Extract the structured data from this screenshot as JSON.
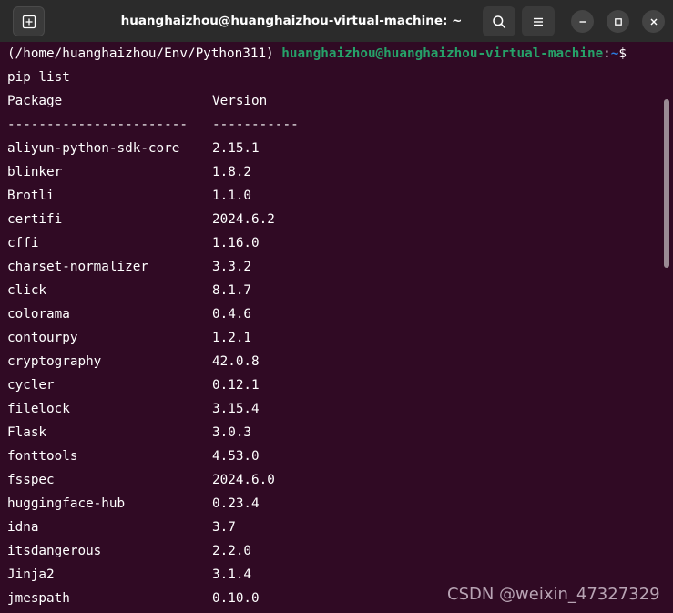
{
  "window": {
    "title": "huanghaizhou@huanghaizhou-virtual-machine: ~"
  },
  "terminal": {
    "prompt": {
      "env": "(/home/huanghaizhou/Env/Python311) ",
      "user_host": "huanghaizhou@huanghaizhou-virtual-machine",
      "colon": ":",
      "path": "~",
      "symbol": "$"
    },
    "command": "pip list",
    "header": {
      "package": "Package",
      "version": "Version"
    },
    "separator": {
      "package": "-----------------------",
      "version": "-----------"
    },
    "packages": [
      {
        "name": "aliyun-python-sdk-core",
        "version": "2.15.1"
      },
      {
        "name": "blinker",
        "version": "1.8.2"
      },
      {
        "name": "Brotli",
        "version": "1.1.0"
      },
      {
        "name": "certifi",
        "version": "2024.6.2"
      },
      {
        "name": "cffi",
        "version": "1.16.0"
      },
      {
        "name": "charset-normalizer",
        "version": "3.3.2"
      },
      {
        "name": "click",
        "version": "8.1.7"
      },
      {
        "name": "colorama",
        "version": "0.4.6"
      },
      {
        "name": "contourpy",
        "version": "1.2.1"
      },
      {
        "name": "cryptography",
        "version": "42.0.8"
      },
      {
        "name": "cycler",
        "version": "0.12.1"
      },
      {
        "name": "filelock",
        "version": "3.15.4"
      },
      {
        "name": "Flask",
        "version": "3.0.3"
      },
      {
        "name": "fonttools",
        "version": "4.53.0"
      },
      {
        "name": "fsspec",
        "version": "2024.6.0"
      },
      {
        "name": "huggingface-hub",
        "version": "0.23.4"
      },
      {
        "name": "idna",
        "version": "3.7"
      },
      {
        "name": "itsdangerous",
        "version": "2.2.0"
      },
      {
        "name": "Jinja2",
        "version": "3.1.4"
      },
      {
        "name": "jmespath",
        "version": "0.10.0"
      }
    ]
  },
  "watermark": "CSDN @weixin_47327329",
  "icons": {
    "new_tab": "new-tab-icon",
    "search": "search-icon",
    "menu": "hamburger-menu-icon",
    "minimize": "minimize-icon",
    "maximize": "maximize-icon",
    "close": "close-icon"
  },
  "colors": {
    "terminal_bg": "#300a24",
    "titlebar_bg": "#2b2b2b",
    "prompt_user": "#26a269",
    "prompt_path": "#2a7bde",
    "text": "#ffffff"
  }
}
